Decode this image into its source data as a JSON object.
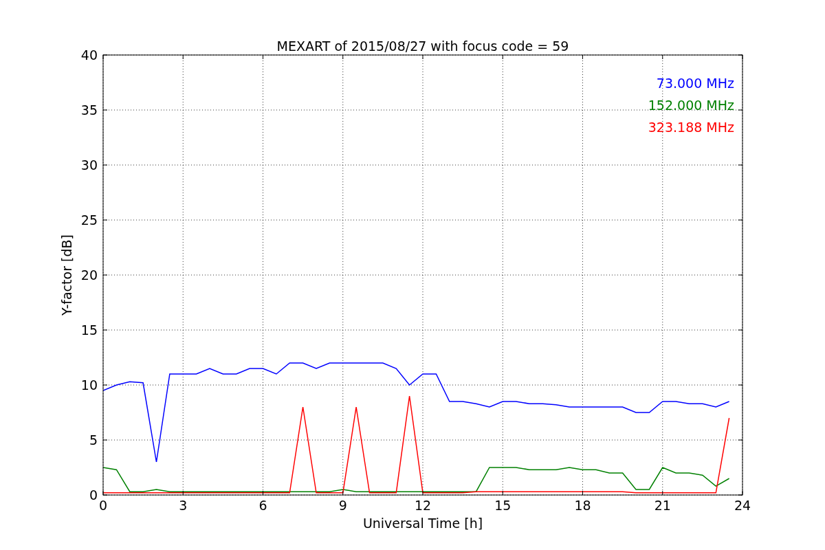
{
  "chart_data": {
    "type": "line",
    "title": "MEXART of 2015/08/27 with focus code = 59",
    "xlabel": "Universal Time [h]",
    "ylabel": "Y-factor [dB]",
    "x": [
      0,
      0.5,
      1,
      1.5,
      2,
      2.5,
      3,
      3.5,
      4,
      4.5,
      5,
      5.5,
      6,
      6.5,
      7,
      7.5,
      8,
      8.5,
      9,
      9.5,
      10,
      10.5,
      11,
      11.5,
      12,
      12.5,
      13,
      13.5,
      14,
      14.5,
      15,
      15.5,
      16,
      16.5,
      17,
      17.5,
      18,
      18.5,
      19,
      19.5,
      20,
      20.5,
      21,
      21.5,
      22,
      22.5,
      23,
      23.5
    ],
    "series": [
      {
        "name": "73.000 MHz",
        "color": "#0000ff",
        "values": [
          9.5,
          10,
          10.3,
          10.2,
          3,
          11,
          11,
          11,
          11.5,
          11,
          11,
          11.5,
          11.5,
          11,
          12,
          12,
          11.5,
          12,
          12,
          12,
          12,
          12,
          11.5,
          10,
          11,
          11,
          8.5,
          8.5,
          8.3,
          8,
          8.5,
          8.5,
          8.3,
          8.3,
          8.2,
          8,
          8,
          8,
          8,
          8,
          7.5,
          7.5,
          8.5,
          8.5,
          8.3,
          8.3,
          8,
          8.5
        ]
      },
      {
        "name": "152.000 MHz",
        "color": "#008000",
        "values": [
          2.5,
          2.3,
          0.3,
          0.3,
          0.5,
          0.3,
          0.3,
          0.3,
          0.3,
          0.3,
          0.3,
          0.3,
          0.3,
          0.3,
          0.3,
          0.3,
          0.3,
          0.3,
          0.5,
          0.3,
          0.3,
          0.3,
          0.3,
          0.3,
          0.3,
          0.3,
          0.3,
          0.3,
          0.3,
          2.5,
          2.5,
          2.5,
          2.3,
          2.3,
          2.3,
          2.5,
          2.3,
          2.3,
          2,
          2,
          0.5,
          0.5,
          2.5,
          2,
          2,
          1.8,
          0.8,
          1.5
        ]
      },
      {
        "name": "323.188 MHz",
        "color": "#ff0000",
        "values": [
          0.2,
          0.2,
          0.2,
          0.2,
          0.2,
          0.2,
          0.2,
          0.2,
          0.2,
          0.2,
          0.2,
          0.2,
          0.2,
          0.2,
          0.2,
          8,
          0.2,
          0.2,
          0.2,
          8,
          0.2,
          0.2,
          0.2,
          9,
          0.2,
          0.2,
          0.2,
          0.2,
          0.3,
          0.3,
          0.3,
          0.3,
          0.3,
          0.3,
          0.3,
          0.3,
          0.3,
          0.3,
          0.3,
          0.3,
          0.2,
          0.2,
          0.2,
          0.2,
          0.2,
          0.2,
          0.2,
          7
        ]
      }
    ],
    "xlim": [
      0,
      24
    ],
    "ylim": [
      0,
      40
    ],
    "xticks": [
      0,
      3,
      6,
      9,
      12,
      15,
      18,
      21,
      24
    ],
    "yticks": [
      0,
      5,
      10,
      15,
      20,
      25,
      30,
      35,
      40
    ],
    "grid": true
  }
}
